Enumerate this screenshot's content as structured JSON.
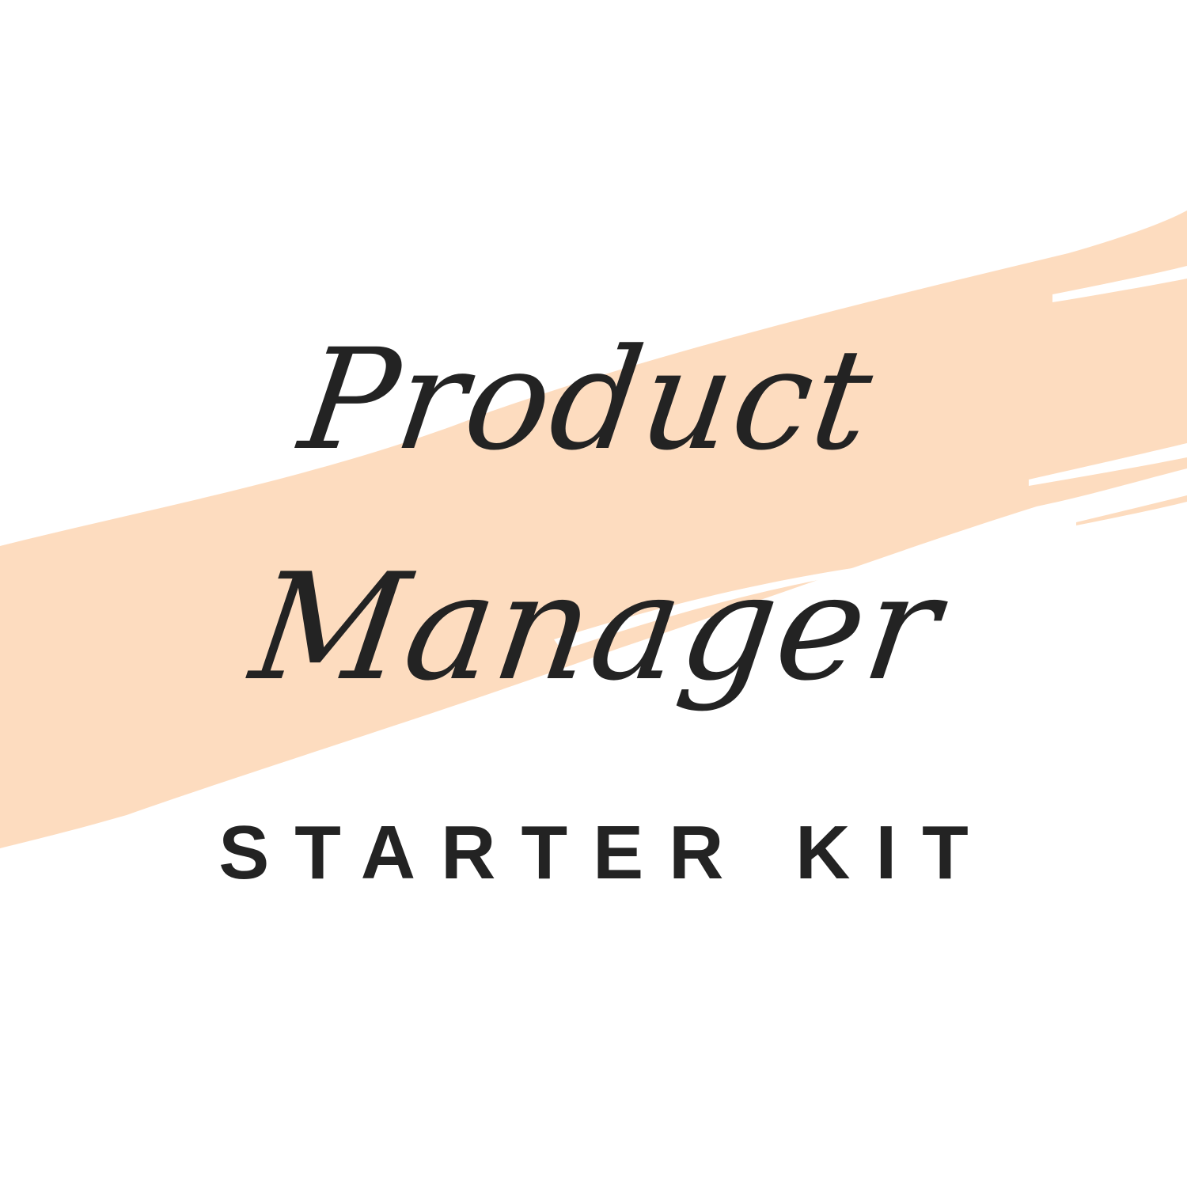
{
  "title": {
    "line1": "Product",
    "line2": "Manager"
  },
  "subtitle": "STARTER KIT",
  "colors": {
    "background": "#ffffff",
    "brush_stroke": "#fddcbf",
    "text": "#232323"
  }
}
